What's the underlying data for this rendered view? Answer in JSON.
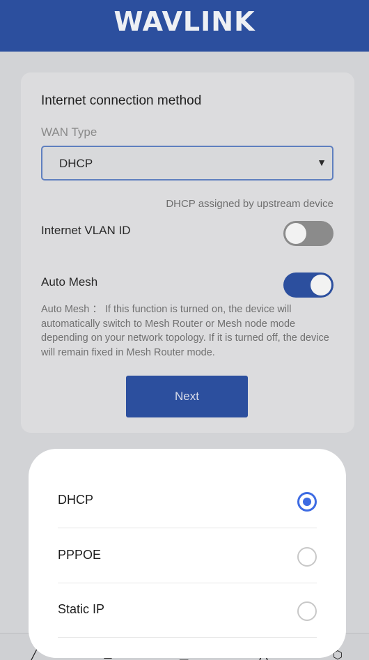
{
  "header": {
    "brand": "WAVLINK"
  },
  "form": {
    "title": "Internet connection method",
    "wan_type_label": "WAN Type",
    "wan_type_value": "DHCP",
    "wan_hint": "DHCP assigned by upstream device",
    "vlan_label": "Internet VLAN ID",
    "vlan_enabled": false,
    "auto_mesh_label": "Auto Mesh",
    "auto_mesh_enabled": true,
    "auto_mesh_desc_key": "Auto Mesh",
    "auto_mesh_desc": "：  If this function is turned on, the device will automatically switch to Mesh Router or Mesh node mode depending on your network topology. If it is turned off, the device will remain fixed in Mesh Router mode.",
    "next_label": "Next"
  },
  "picker": {
    "options": [
      {
        "label": "DHCP",
        "selected": true
      },
      {
        "label": "PPPOE",
        "selected": false
      },
      {
        "label": "Static IP",
        "selected": false
      }
    ]
  },
  "colors": {
    "brand": "#2c4f9e",
    "radio_selected": "#3d6be3"
  }
}
